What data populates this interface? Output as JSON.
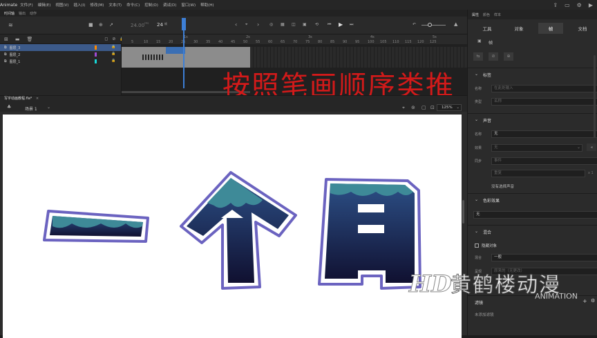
{
  "menubar": {
    "app": "Animate",
    "items": [
      "文件(F)",
      "编辑(E)",
      "视图(V)",
      "插入(I)",
      "修改(M)",
      "文本(T)",
      "命令(C)",
      "控制(O)",
      "调试(D)",
      "窗口(W)",
      "帮助(H)"
    ]
  },
  "tl_tabs": [
    "时间轴",
    "输出",
    "动作"
  ],
  "timeline": {
    "fps": "24.00",
    "fps_unit": "FPS",
    "frame": "24",
    "frame_unit": "帧",
    "ruler": [
      "5",
      "10",
      "15",
      "20",
      "25",
      "30",
      "35",
      "40",
      "45",
      "50",
      "55",
      "60",
      "65",
      "70",
      "75",
      "80",
      "85",
      "90",
      "95",
      "100",
      "105",
      "110",
      "115",
      "120",
      "125"
    ],
    "sec_marks": [
      "1s",
      "2s",
      "3s",
      "4s",
      "5s"
    ],
    "layers": [
      {
        "name": "图层_3",
        "color": "#ff8a00"
      },
      {
        "name": "图层_2",
        "color": "#a04bd4"
      },
      {
        "name": "图层_1",
        "color": "#17d6d6"
      }
    ]
  },
  "overlay_text": "按照笔画顺序类推",
  "document": {
    "tab": "写字动画教程.fla*",
    "scene": "场景 1",
    "zoom": "125%"
  },
  "artwork": {
    "chars": [
      "一",
      "个",
      "月"
    ]
  },
  "panel": {
    "tabs": [
      "属性",
      "颜色",
      "样本"
    ],
    "subtabs": [
      "工具",
      "对象",
      "帧",
      "文档"
    ],
    "frame_label": "帧",
    "label_section": "标签",
    "name_label": "名称",
    "name_placeholder": "在此处输入",
    "type_label": "类型",
    "type_value": "名称",
    "sound_section": "声音",
    "sound_name_label": "名称",
    "sound_name_value": "无",
    "effect_label": "效果",
    "effect_value": "无",
    "sync_label": "同步",
    "sync_value": "事件",
    "repeat_value": "重复",
    "repeat_count": "x 1",
    "no_sound": "没有选择声音",
    "color_section": "色彩效果",
    "color_value": "无",
    "blend_section": "混合",
    "hide_object": "隐藏对象",
    "blend_label": "混合",
    "blend_value": "一般",
    "render_label": "呈现",
    "render_value": "原来的（无更改）",
    "filter_label": "滤镜",
    "no_filter": "未添加滤镜"
  },
  "watermark": {
    "hd": "HD",
    "cn": "黄鹤楼动漫",
    "en": "ANIMATION"
  },
  "colors": {
    "accent": "#3d7fd6",
    "selected_layer": "#3c5a8a",
    "overlay_red": "#d21a1a",
    "glyph_border": "#6b63c0",
    "glyph_fill_top": "#4a8aa0",
    "glyph_fill_bottom": "#121233"
  }
}
